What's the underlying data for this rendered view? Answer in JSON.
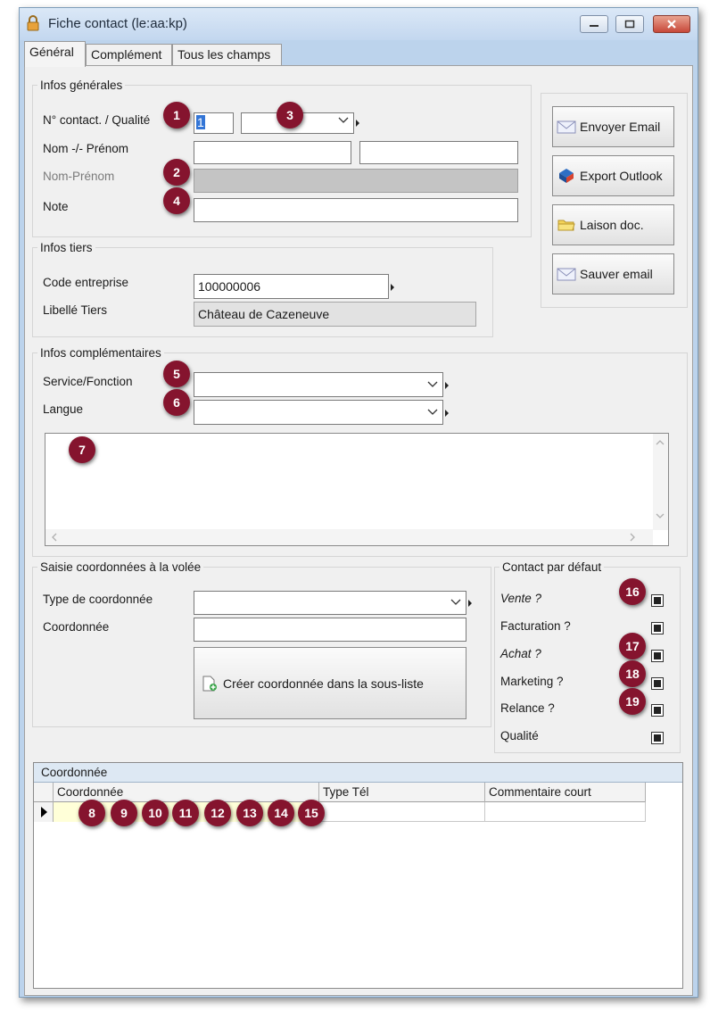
{
  "window": {
    "title": "Fiche contact (le:aa:kp)"
  },
  "tabs": [
    "Général",
    "Complément",
    "Tous les champs"
  ],
  "infos_generales": {
    "legend": "Infos générales",
    "num_contact_label": "N° contact. / Qualité",
    "num_contact_value": "1",
    "nom_prenom_label": "Nom -/- Prénom",
    "nom_prenom_combined_label": "Nom-Prénom",
    "note_label": "Note"
  },
  "actions": {
    "envoyer_email": "Envoyer Email",
    "export_outlook": "Export Outlook",
    "liaison_doc": "Laison doc.",
    "sauver_email": "Sauver email"
  },
  "infos_tiers": {
    "legend": "Infos tiers",
    "code_label": "Code entreprise",
    "code_value": "100000006",
    "libelle_label": "Libellé Tiers",
    "libelle_value": "Château de Cazeneuve"
  },
  "infos_complementaires": {
    "legend": "Infos complémentaires",
    "service_label": "Service/Fonction",
    "langue_label": "Langue"
  },
  "saisie": {
    "legend": "Saisie coordonnées à la volée",
    "type_label": "Type de coordonnée",
    "coord_label": "Coordonnée",
    "create_button": "Créer coordonnée dans la sous-liste"
  },
  "contact_defaut": {
    "legend": "Contact par défaut",
    "items": [
      "Vente ?",
      "Facturation ?",
      "Achat ?",
      "Marketing ?",
      "Relance ?",
      "Qualité"
    ]
  },
  "grid": {
    "title": "Coordonnée",
    "columns": [
      "Coordonnée",
      "Type Tél",
      "Commentaire court"
    ]
  },
  "badges": [
    "1",
    "2",
    "3",
    "4",
    "5",
    "6",
    "7",
    "8",
    "9",
    "10",
    "11",
    "12",
    "13",
    "14",
    "15",
    "16",
    "17",
    "18",
    "19"
  ],
  "colors": {
    "badge": "#85142e",
    "window_frame": "#bcd3ec",
    "panel": "#f0f0f0"
  }
}
